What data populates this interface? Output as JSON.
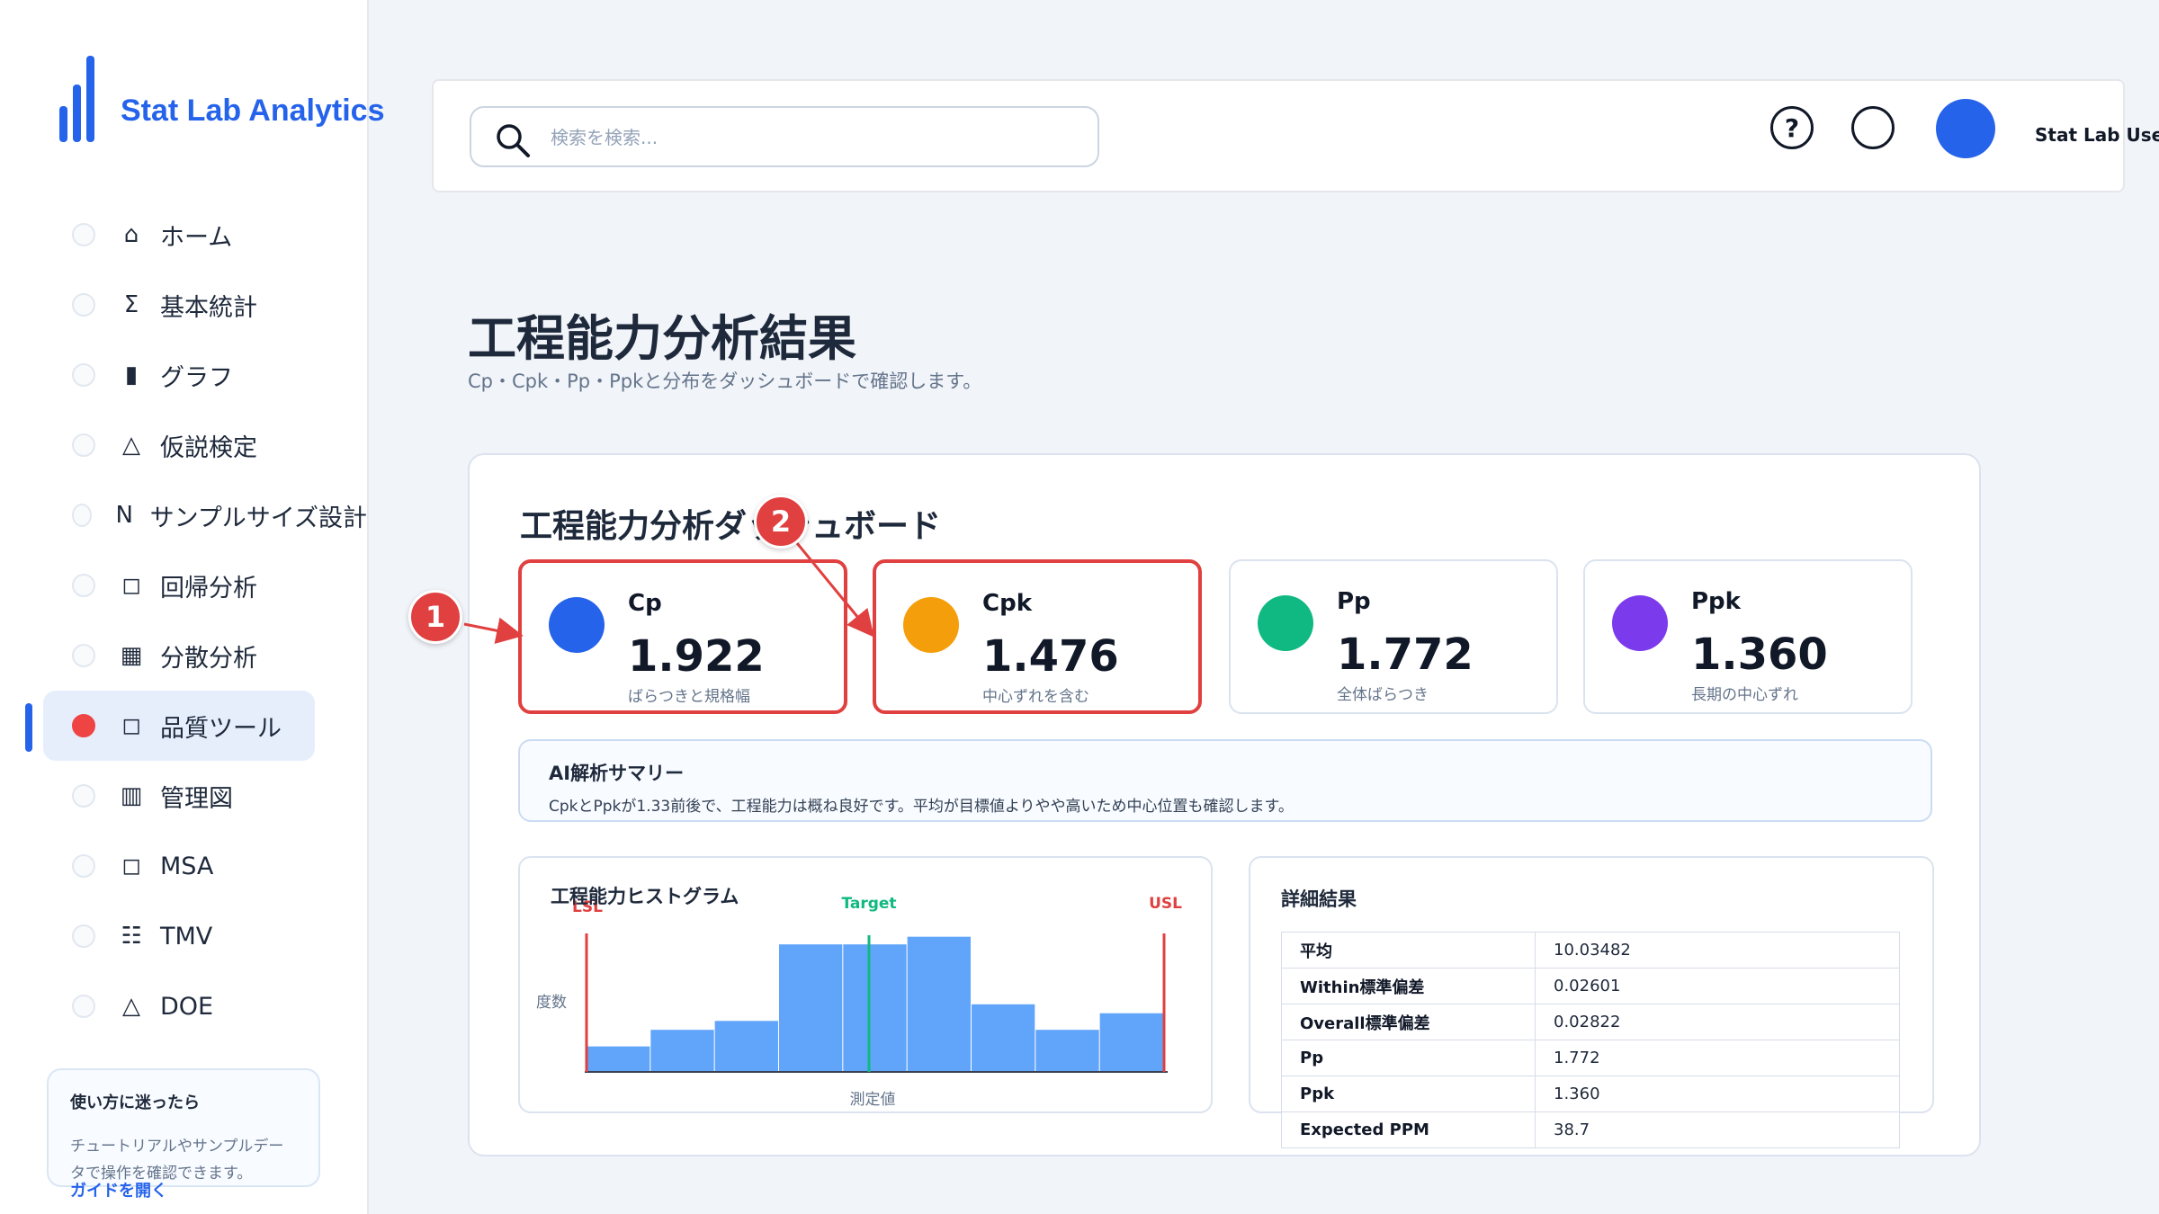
{
  "brand": {
    "title": "Stat Lab Analytics"
  },
  "sidebar": {
    "items": [
      {
        "icon": "⌂",
        "icon_name": "home-icon",
        "label": "ホーム"
      },
      {
        "icon": "Σ",
        "icon_name": "sigma-icon",
        "label": "基本統計"
      },
      {
        "icon": "▮",
        "icon_name": "bar-chart-icon",
        "label": "グラフ"
      },
      {
        "icon": "△",
        "icon_name": "triangle-icon",
        "label": "仮説検定"
      },
      {
        "icon": "N",
        "icon_name": "n-icon",
        "label": "サンプルサイズ設計"
      },
      {
        "icon": "◻",
        "icon_name": "square-icon",
        "label": "回帰分析"
      },
      {
        "icon": "▦",
        "icon_name": "grid-icon",
        "label": "分散分析"
      },
      {
        "icon": "◻",
        "icon_name": "square-icon",
        "label": "品質ツール",
        "active": true
      },
      {
        "icon": "▥",
        "icon_name": "control-chart-icon",
        "label": "管理図"
      },
      {
        "icon": "◻",
        "icon_name": "square-icon",
        "label": "MSA"
      },
      {
        "icon": "☷",
        "icon_name": "list-icon",
        "label": "TMV"
      },
      {
        "icon": "△",
        "icon_name": "triangle-icon",
        "label": "DOE"
      }
    ],
    "help": {
      "title": "使い方に迷ったら",
      "text": "チュートリアルやサンプルデータで操作を確認できます。",
      "link": "ガイドを開く"
    }
  },
  "header": {
    "search_placeholder": "検索を検索...",
    "help_icon": "?",
    "user_name": "Stat Lab User"
  },
  "page": {
    "title": "工程能力分析結果",
    "subtitle": "Cp・Cpk・Pp・Ppkと分布をダッシュボードで確認します。"
  },
  "dashboard": {
    "title": "工程能力分析ダッシュボード",
    "kpis": [
      {
        "label": "Cp",
        "value": "1.922",
        "sub": "ばらつきと規格幅",
        "color": "#2563eb"
      },
      {
        "label": "Cpk",
        "value": "1.476",
        "sub": "中心ずれを含む",
        "color": "#f59e0b"
      },
      {
        "label": "Pp",
        "value": "1.772",
        "sub": "全体ばらつき",
        "color": "#10b981"
      },
      {
        "label": "Ppk",
        "value": "1.360",
        "sub": "長期の中心ずれ",
        "color": "#7c3aed"
      }
    ],
    "summary": {
      "title": "AI解析サマリー",
      "text": "CpkとPpkが1.33前後で、工程能力は概ね良好です。平均が目標値よりやや高いため中心位置も確認します。"
    },
    "callouts": [
      "1",
      "2"
    ]
  },
  "chart_data": {
    "type": "bar",
    "title": "工程能力ヒストグラム",
    "xlabel": "測定値",
    "ylabel": "度数",
    "values": [
      2,
      3.3,
      4,
      10,
      10,
      10.6,
      5.3,
      3.3,
      4.6
    ],
    "ylim": [
      0,
      11
    ],
    "reference_lines": [
      {
        "label": "LSL",
        "color": "#e0403f"
      },
      {
        "label": "Target",
        "color": "#10b981"
      },
      {
        "label": "USL",
        "color": "#e0403f"
      }
    ],
    "bar_color": "#60a5fa"
  },
  "details": {
    "title": "詳細結果",
    "rows": [
      {
        "key": "平均",
        "value": "10.03482"
      },
      {
        "key": "Within標準偏差",
        "value": "0.02601"
      },
      {
        "key": "Overall標準偏差",
        "value": "0.02822"
      },
      {
        "key": "Pp",
        "value": "1.772"
      },
      {
        "key": "Ppk",
        "value": "1.360"
      },
      {
        "key": "Expected PPM",
        "value": "38.7"
      }
    ]
  }
}
